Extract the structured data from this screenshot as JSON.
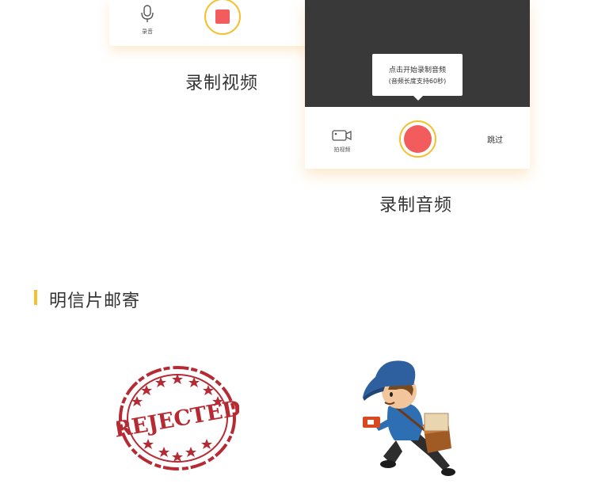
{
  "video_card": {
    "record_label": "录音",
    "caption": "录制视频"
  },
  "audio_card": {
    "tooltip_line1": "点击开始录制音频",
    "tooltip_line2": "(音频长度支持60秒)",
    "camera_label": "拍视频",
    "skip_label": "跳过",
    "caption": "录制音频"
  },
  "section": {
    "title": "明信片邮寄"
  },
  "stamp": {
    "text": "REJECTED"
  },
  "colors": {
    "accent_yellow": "#f5c02e",
    "record_red": "#f25c5c",
    "dark_bg": "#393939",
    "stamp_red": "#b62a34"
  },
  "icons": [
    "microphone-icon",
    "stop-icon",
    "video-camera-icon",
    "record-icon",
    "rejected-stamp",
    "courier-illustration"
  ]
}
